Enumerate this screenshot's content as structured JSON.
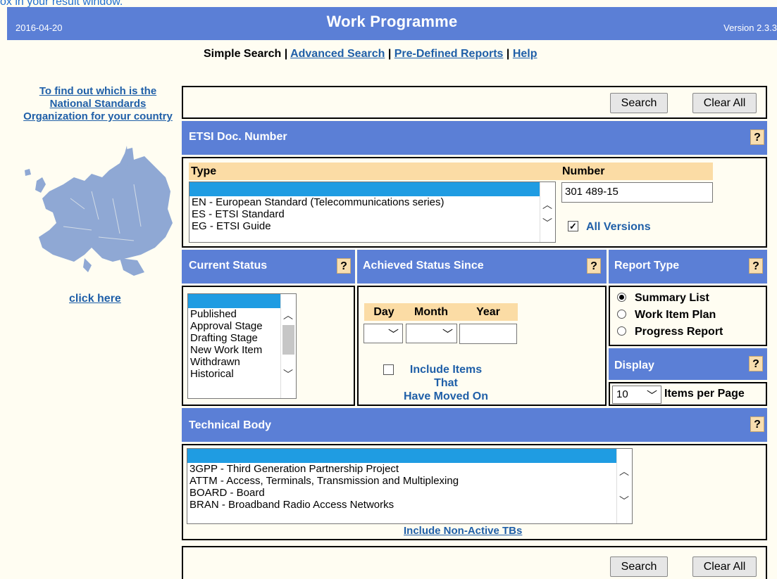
{
  "top_note": "ox in your result window.",
  "header": {
    "date": "2016-04-20",
    "title": "Work Programme",
    "version": "Version 2.3.3"
  },
  "nav": {
    "current": "Simple Search",
    "sep": "|",
    "advanced": "Advanced Search",
    "reports": "Pre-Defined Reports",
    "help": "Help"
  },
  "sidebar": {
    "nso_link": "To find out which is the National Standards Organization for your country",
    "click_here": "click here"
  },
  "buttons": {
    "search": "Search",
    "clear": "Clear All"
  },
  "help_symbol": "?",
  "etsi_doc": {
    "title": "ETSI Doc. Number",
    "type_label": "Type",
    "number_label": "Number",
    "number_value": "301 489-15",
    "all_versions_label": "All Versions",
    "all_versions_checked": true,
    "type_options": [
      "EN - European Standard (Telecommunications series)",
      "ES - ETSI Standard",
      "EG - ETSI Guide"
    ]
  },
  "current_status": {
    "title": "Current Status",
    "options": [
      "Published",
      "Approval Stage",
      "Drafting Stage",
      "New Work Item",
      "Withdrawn",
      "Historical"
    ]
  },
  "achieved_status": {
    "title": "Achieved Status Since",
    "day_label": "Day",
    "month_label": "Month",
    "year_label": "Year",
    "include_moved_label_1": "Include Items That",
    "include_moved_label_2": "Have Moved On"
  },
  "report_type": {
    "title": "Report Type",
    "options": [
      "Summary List",
      "Work Item Plan",
      "Progress Report"
    ],
    "selected_index": 0
  },
  "display": {
    "title": "Display",
    "items_value": "10",
    "items_label": "Items per Page"
  },
  "technical_body": {
    "title": "Technical Body",
    "options": [
      "3GPP - Third Generation Partnership Project",
      "ATTM - Access, Terminals, Transmission and Multiplexing",
      "BOARD - Board",
      "BRAN - Broadband Radio Access Networks"
    ],
    "include_non_active": "Include Non-Active TBs"
  },
  "colors": {
    "header_blue": "#5b7fd6",
    "page_bg": "#fffdf2",
    "label_bg": "#fbdca5",
    "link": "#1f5fa8",
    "selected": "#1f9ce2"
  },
  "icons": [
    "europe-map",
    "question-icon",
    "chevron-up-icon",
    "chevron-down-icon",
    "radio-icon",
    "checkbox-icon"
  ]
}
